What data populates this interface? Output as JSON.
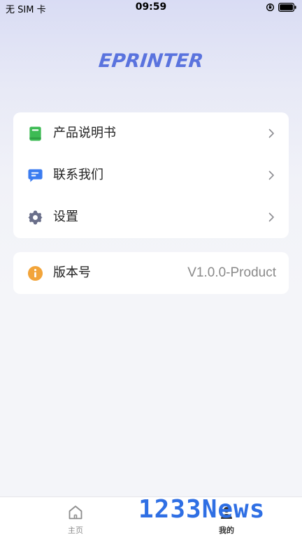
{
  "status_bar": {
    "carrier": "无 SIM 卡",
    "time": "09:59",
    "icons": [
      "rotation-lock-icon",
      "battery-icon"
    ]
  },
  "brand": {
    "logo_text": "EPRINTER",
    "color": "#5a73de"
  },
  "menu": {
    "items": [
      {
        "label": "产品说明书",
        "icon": "book-icon",
        "icon_color": "#3dbb54"
      },
      {
        "label": "联系我们",
        "icon": "message-icon",
        "icon_color": "#3b7cf0"
      },
      {
        "label": "设置",
        "icon": "gear-icon",
        "icon_color": "#6a6f8a"
      }
    ]
  },
  "version": {
    "label": "版本号",
    "value": "V1.0.0-Product",
    "icon": "info-icon",
    "icon_color": "#f2a43a"
  },
  "tab_bar": {
    "tabs": [
      {
        "label": "主页",
        "icon": "home-icon",
        "active": false
      },
      {
        "label": "我的",
        "icon": "profile-icon",
        "active": true
      }
    ]
  },
  "watermark": {
    "text": "1233News",
    "color": "#2f6fe4"
  }
}
